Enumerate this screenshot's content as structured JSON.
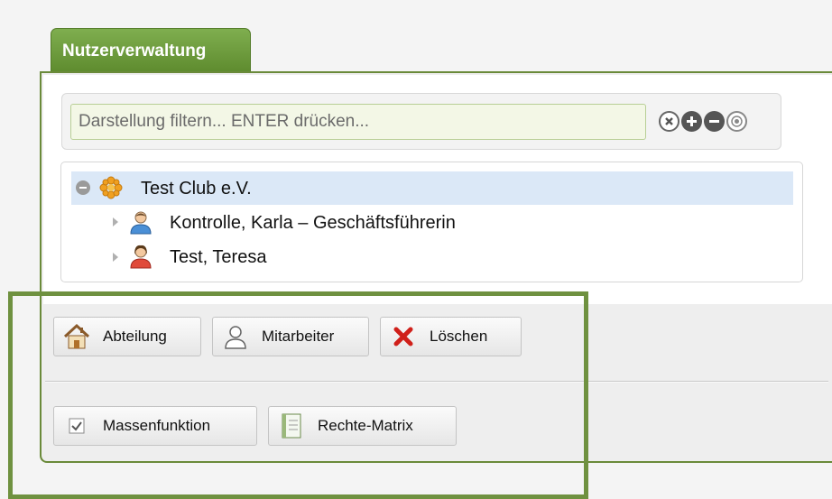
{
  "tab": {
    "label": "Nutzerverwaltung"
  },
  "filter": {
    "placeholder": "Darstellung filtern... ENTER drücken..."
  },
  "filter_controls": [
    "clear-icon",
    "expand-all-icon",
    "collapse-all-icon",
    "target-icon"
  ],
  "tree": {
    "root": {
      "label": "Test Club e.V.",
      "expanded": true,
      "selected": true
    },
    "children": [
      {
        "label": "Kontrolle, Karla – Geschäftsführerin",
        "icon": "user-male-icon"
      },
      {
        "label": "Test, Teresa",
        "icon": "user-female-icon"
      }
    ]
  },
  "toolbar_primary": {
    "department_label": "Abteilung",
    "employee_label": "Mitarbeiter",
    "delete_label": "Löschen"
  },
  "toolbar_secondary": {
    "bulk_label": "Massenfunktion",
    "matrix_label": "Rechte-Matrix"
  },
  "colors": {
    "accent_green": "#6f9140",
    "selection_blue": "#dbe8f7"
  }
}
